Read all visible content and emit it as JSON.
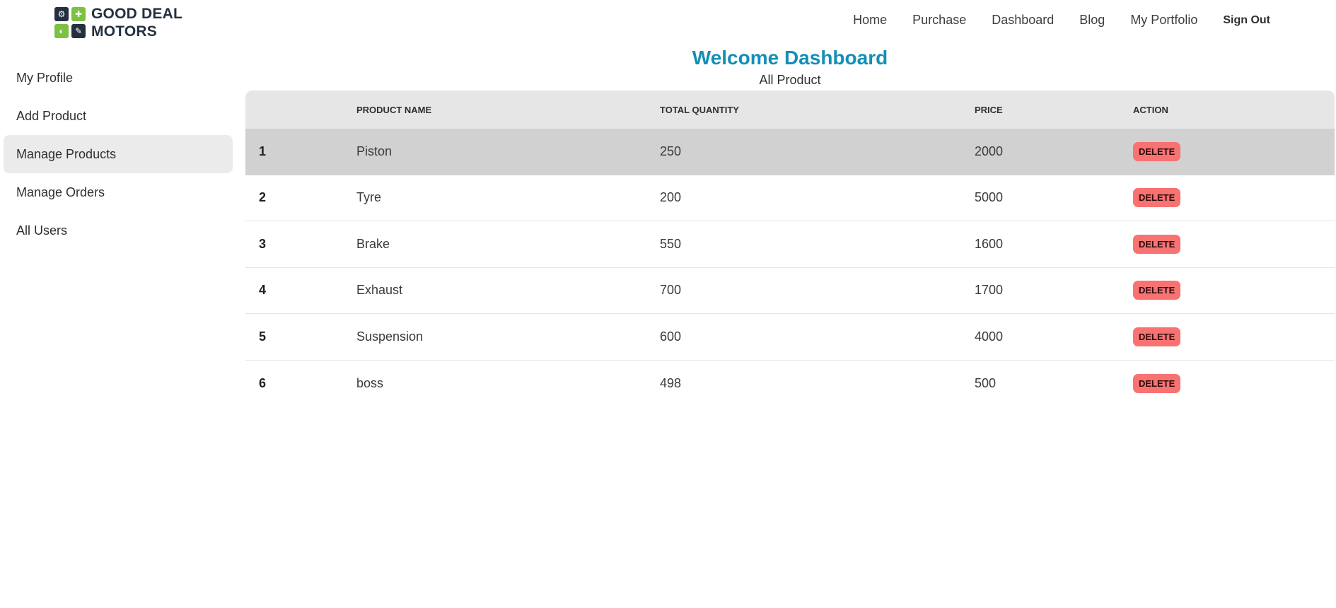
{
  "brand": {
    "line1": "GOOD DEAL",
    "line2": "MOTORS",
    "colors": {
      "dark": "#243040",
      "green": "#7dc142"
    }
  },
  "nav": {
    "links": [
      "Home",
      "Purchase",
      "Dashboard",
      "Blog",
      "My Portfolio"
    ],
    "signout": "Sign Out"
  },
  "sidebar": {
    "items": [
      {
        "label": "My Profile"
      },
      {
        "label": "Add Product"
      },
      {
        "label": "Manage Products"
      },
      {
        "label": "Manage Orders"
      },
      {
        "label": "All Users"
      }
    ]
  },
  "main": {
    "title": "Welcome Dashboard",
    "subtitle": "All Product",
    "title_color": "#138fb7"
  },
  "table": {
    "headers": [
      "",
      "Product Name",
      "Total Quantity",
      "Price",
      "Action"
    ],
    "rows": [
      {
        "index": "1",
        "name": "Piston",
        "quantity": "250",
        "price": "2000",
        "action": "Delete"
      },
      {
        "index": "2",
        "name": "Tyre",
        "quantity": "200",
        "price": "5000",
        "action": "Delete"
      },
      {
        "index": "3",
        "name": "Brake",
        "quantity": "550",
        "price": "1600",
        "action": "Delete"
      },
      {
        "index": "4",
        "name": "Exhaust",
        "quantity": "700",
        "price": "1700",
        "action": "Delete"
      },
      {
        "index": "5",
        "name": "Suspension",
        "quantity": "600",
        "price": "4000",
        "action": "Delete"
      },
      {
        "index": "6",
        "name": "boss",
        "quantity": "498",
        "price": "500",
        "action": "Delete"
      }
    ],
    "delete_color": "#f87272"
  }
}
